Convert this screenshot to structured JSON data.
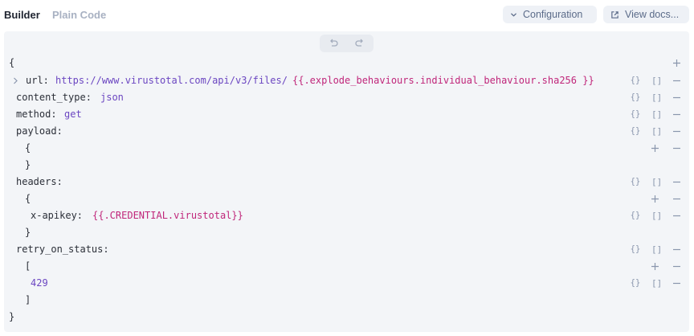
{
  "tabs": {
    "builder": "Builder",
    "plain_code": "Plain Code"
  },
  "actions": {
    "configuration": "Configuration",
    "view_docs": "View docs..."
  },
  "editor": {
    "open_brace": "{",
    "close_brace": "}",
    "url_key": "url:",
    "url_value": "https://www.virustotal.com/api/v3/files/",
    "url_template": "{{.explode_behaviours.individual_behaviour.sha256 }}",
    "content_type_key": "content_type:",
    "content_type_value": "json",
    "method_key": "method:",
    "method_value": "get",
    "payload_key": "payload:",
    "payload_open": "{",
    "payload_close": "}",
    "headers_key": "headers:",
    "headers_open": "{",
    "headers_close": "}",
    "apikey_key": "x-apikey:",
    "apikey_value": "{{.CREDENTIAL.virustotal}}",
    "retry_key": "retry_on_status:",
    "retry_open": "[",
    "retry_close": "]",
    "retry_value": "429",
    "obj_glyph": "{}",
    "arr_glyph": "[]"
  },
  "colors": {
    "accent": "#6b46c1",
    "template": "#c0267a",
    "muted": "#8a96ad",
    "panel": "#f3f5f8"
  },
  "icons": [
    "chevron-down-icon",
    "external-link-icon",
    "undo-icon",
    "redo-icon",
    "chevron-right-icon",
    "plus-icon",
    "minus-icon"
  ]
}
